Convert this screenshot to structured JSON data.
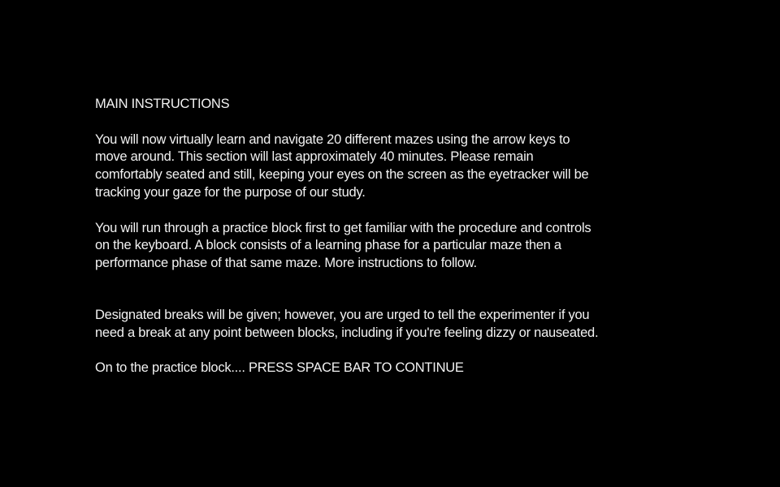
{
  "instructions": {
    "heading": "MAIN INSTRUCTIONS",
    "paragraph_1": "You will now virtually learn and navigate 20 different mazes using the arrow keys to\nmove around. This section will last approximately 40 minutes. Please remain\ncomfortably seated and still, keeping your eyes on the screen as the eyetracker will be\ntracking your gaze for the purpose of our study.",
    "paragraph_2": "You will run through a practice block first to get familiar with the procedure and controls\non the keyboard. A block consists of a learning phase for a particular maze then a\nperformance phase of that same maze. More instructions to follow.",
    "paragraph_3": "Designated breaks will be given; however, you are urged to tell the experimenter if you\nneed a break at any point between blocks, including if you're feeling dizzy or nauseated.",
    "continue_prompt": "On to the practice block.... PRESS SPACE BAR TO CONTINUE"
  },
  "colors": {
    "background": "#000000",
    "text": "#f2f2f2"
  }
}
